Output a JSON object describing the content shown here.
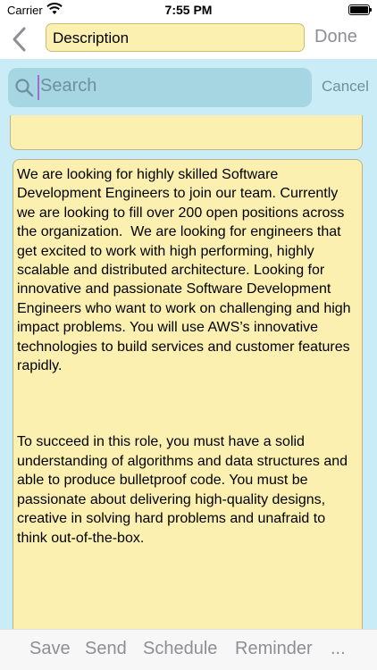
{
  "status_bar": {
    "carrier": "Carrier",
    "time": "7:55 PM"
  },
  "nav": {
    "title_value": "Description",
    "done_label": "Done"
  },
  "search": {
    "placeholder": "Search",
    "cancel_label": "Cancel"
  },
  "note": {
    "paragraph1": "We are looking for highly skilled Software Development Engineers to join our team. Currently we are looking to fill over 200 open positions across the organization.  We are looking for engineers that get excited to work with high performing, highly scalable and distributed architecture. Looking for innovative and passionate Software Development Engineers who want to work on challenging and high impact problems. You will use AWS’s innovative technologies to build services and customer features rapidly.",
    "paragraph2": "To succeed in this role, you must have a solid understanding of algorithms and data structures and able to produce bulletproof code. You must be passionate about delivering high-quality designs, creative in solving hard problems and unafraid to think out-of-the-box."
  },
  "toolbar": {
    "save_label": "Save",
    "send_label": "Send",
    "schedule_label": "Schedule",
    "reminder_label": "Reminder",
    "more_label": "..."
  },
  "colors": {
    "note_background": "#fcf0b0",
    "search_area_background": "#c9ecf7",
    "search_field_background": "#a7d6e3",
    "inactive_text": "#8e8e93"
  }
}
